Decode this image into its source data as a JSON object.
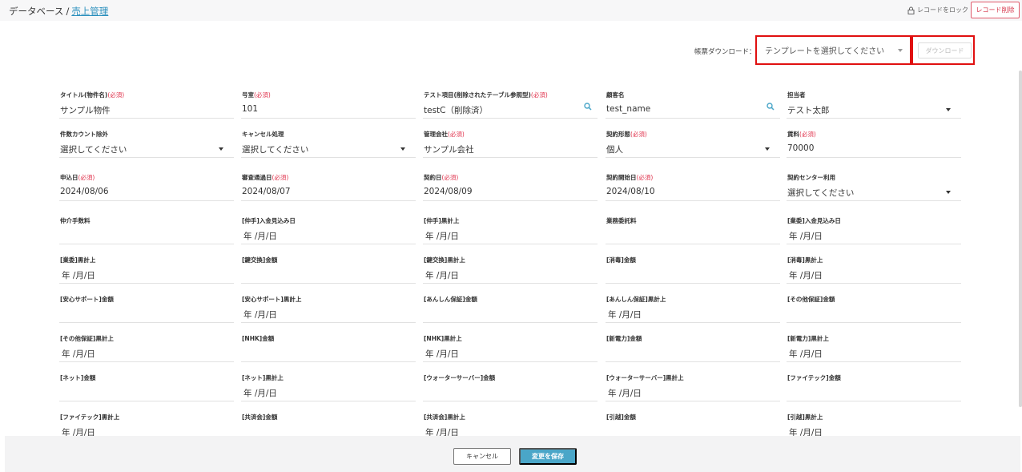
{
  "breadcrumb": {
    "root": "データベース",
    "separator": "/",
    "current": "売上管理"
  },
  "header": {
    "lock_label": "レコードをロック",
    "delete_label": "レコード削除"
  },
  "download": {
    "label": "帳票ダウンロード：",
    "template_placeholder": "テンプレートを選択してください",
    "button_label": "ダウンロード"
  },
  "required_mark": "(必須)",
  "colors": {
    "accent": "#4aa6c8",
    "link": "#2a8fbd",
    "required": "#e0314b",
    "highlight": "#e01010"
  },
  "fields": [
    {
      "label": "タイトル(物件名)",
      "required": true,
      "value": "サンプル物件",
      "control": "text"
    },
    {
      "label": "号室",
      "required": true,
      "value": "101",
      "control": "text"
    },
    {
      "label": "テスト項目(削除されたテーブル参照型)",
      "required": true,
      "value": "testC（削除済）",
      "control": "search"
    },
    {
      "label": "顧客名",
      "required": false,
      "value": "test_name",
      "control": "search"
    },
    {
      "label": "担当者",
      "required": false,
      "value": "テスト太郎",
      "control": "select"
    },
    {
      "label": "件数カウント除外",
      "required": false,
      "value": "選択してください",
      "control": "select"
    },
    {
      "label": "キャンセル処理",
      "required": false,
      "value": "選択してください",
      "control": "select"
    },
    {
      "label": "管理会社",
      "required": true,
      "value": "サンプル会社",
      "control": "text"
    },
    {
      "label": "契約形態",
      "required": true,
      "value": "個人",
      "control": "select"
    },
    {
      "label": "賃料",
      "required": true,
      "value": "70000",
      "control": "text"
    },
    {
      "label": "申込日",
      "required": true,
      "value": "2024/08/06",
      "control": "text"
    },
    {
      "label": "審査通過日",
      "required": true,
      "value": "2024/08/07",
      "control": "text"
    },
    {
      "label": "契約日",
      "required": true,
      "value": "2024/08/09",
      "control": "text"
    },
    {
      "label": "契約開始日",
      "required": true,
      "value": "2024/08/10",
      "control": "text"
    },
    {
      "label": "契約センター利用",
      "required": false,
      "value": "選択してください",
      "control": "select"
    },
    {
      "label": "仲介手数料",
      "required": false,
      "value": "",
      "control": "text"
    },
    {
      "label": "[仲手]入金見込み日",
      "required": false,
      "value": "年 /月/日",
      "control": "date"
    },
    {
      "label": "[仲手]黒計上",
      "required": false,
      "value": "年 /月/日",
      "control": "date"
    },
    {
      "label": "業務委託料",
      "required": false,
      "value": "",
      "control": "text"
    },
    {
      "label": "[業委]入金見込み日",
      "required": false,
      "value": "年 /月/日",
      "control": "date"
    },
    {
      "label": "[業委]黒計上",
      "required": false,
      "value": "年 /月/日",
      "control": "date"
    },
    {
      "label": "[鍵交換]金額",
      "required": false,
      "value": "",
      "control": "text"
    },
    {
      "label": "[鍵交換]黒計上",
      "required": false,
      "value": "年 /月/日",
      "control": "date"
    },
    {
      "label": "[消毒]金額",
      "required": false,
      "value": "",
      "control": "text"
    },
    {
      "label": "[消毒]黒計上",
      "required": false,
      "value": "年 /月/日",
      "control": "date"
    },
    {
      "label": "[安心サポート]金額",
      "required": false,
      "value": "",
      "control": "text"
    },
    {
      "label": "[安心サポート]黒計上",
      "required": false,
      "value": "年 /月/日",
      "control": "date"
    },
    {
      "label": "[あんしん保証]金額",
      "required": false,
      "value": "",
      "control": "text"
    },
    {
      "label": "[あんしん保証]黒計上",
      "required": false,
      "value": "年 /月/日",
      "control": "date"
    },
    {
      "label": "[その他保証]金額",
      "required": false,
      "value": "",
      "control": "text"
    },
    {
      "label": "[その他保証]黒計上",
      "required": false,
      "value": "年 /月/日",
      "control": "date"
    },
    {
      "label": "[NHK]金額",
      "required": false,
      "value": "",
      "control": "text"
    },
    {
      "label": "[NHK]黒計上",
      "required": false,
      "value": "年 /月/日",
      "control": "date"
    },
    {
      "label": "[新電力]金額",
      "required": false,
      "value": "",
      "control": "text"
    },
    {
      "label": "[新電力]黒計上",
      "required": false,
      "value": "年 /月/日",
      "control": "date"
    },
    {
      "label": "[ネット]金額",
      "required": false,
      "value": "",
      "control": "text"
    },
    {
      "label": "[ネット]黒計上",
      "required": false,
      "value": "年 /月/日",
      "control": "date"
    },
    {
      "label": "[ウォーターサーバー]金額",
      "required": false,
      "value": "",
      "control": "text"
    },
    {
      "label": "[ウォーターサーバー]黒計上",
      "required": false,
      "value": "年 /月/日",
      "control": "date"
    },
    {
      "label": "[ファイテック]金額",
      "required": false,
      "value": "",
      "control": "text"
    },
    {
      "label": "[ファイテック]黒計上",
      "required": false,
      "value": "年 /月/日",
      "control": "date"
    },
    {
      "label": "[共済会]金額",
      "required": false,
      "value": "",
      "control": "text"
    },
    {
      "label": "[共済会]黒計上",
      "required": false,
      "value": "年 /月/日",
      "control": "date"
    },
    {
      "label": "[引越]金額",
      "required": false,
      "value": "",
      "control": "text"
    },
    {
      "label": "[引越]黒計上",
      "required": false,
      "value": "年 /月/日",
      "control": "date"
    }
  ],
  "footer": {
    "cancel_label": "キャンセル",
    "save_label": "変更を保存"
  }
}
